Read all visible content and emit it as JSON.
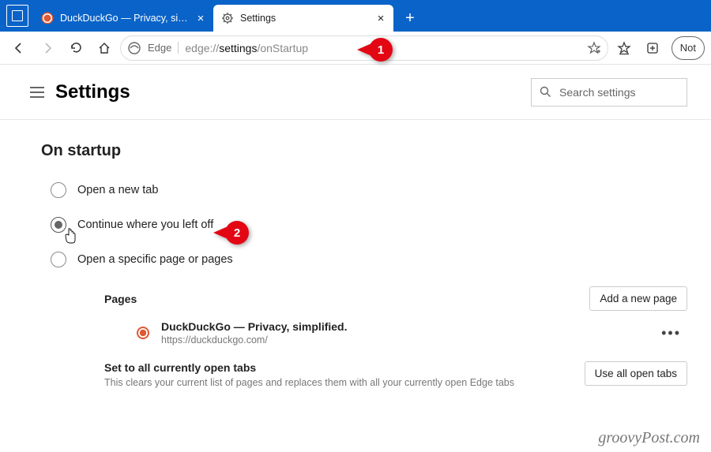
{
  "tabs": [
    {
      "label": "DuckDuckGo — Privacy, simplified."
    },
    {
      "label": "Settings"
    }
  ],
  "addressbar": {
    "browser_label": "Edge",
    "url_prefix": "edge://",
    "url_bold": "settings",
    "url_suffix": "/onStartup"
  },
  "toolbar_right": {
    "not_label": "Not"
  },
  "header": {
    "title": "Settings",
    "search_placeholder": "Search settings"
  },
  "section": {
    "title": "On startup",
    "options": [
      "Open a new tab",
      "Continue where you left off",
      "Open a specific page or pages"
    ],
    "pages": {
      "label": "Pages",
      "add_button": "Add a new page",
      "items": [
        {
          "title": "DuckDuckGo — Privacy, simplified.",
          "url": "https://duckduckgo.com/"
        }
      ]
    },
    "set_all": {
      "title": "Set to all currently open tabs",
      "desc": "This clears your current list of pages and replaces them with all your currently open Edge tabs",
      "button": "Use all open tabs"
    }
  },
  "callouts": {
    "one": "1",
    "two": "2"
  },
  "watermark": "groovyPost.com"
}
